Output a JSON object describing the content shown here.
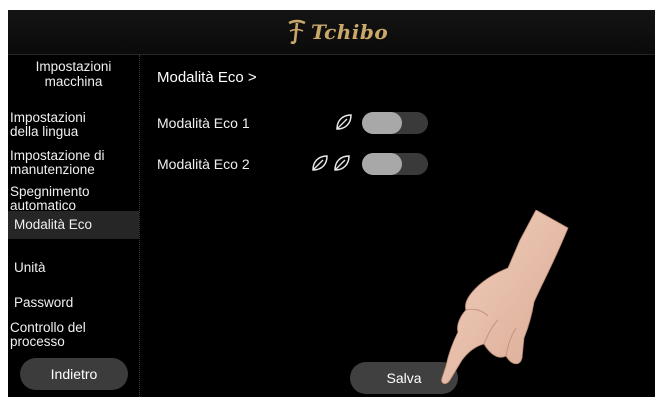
{
  "header": {
    "brand": "Tchibo",
    "logo_icon": "tchibo-cup-icon"
  },
  "sidebar": {
    "title_line1": "Impostazioni",
    "title_line2": "macchina",
    "items": [
      {
        "line1": "Impostazioni",
        "line2": "della lingua"
      },
      {
        "line1": "Impostazione di",
        "line2": "manutenzione"
      },
      {
        "line1": "Spegnimento",
        "line2": "automatico"
      },
      {
        "line1": "Modalità Eco",
        "line2": "",
        "active": true
      },
      {
        "line1": "Unità",
        "line2": ""
      },
      {
        "line1": "Password",
        "line2": ""
      },
      {
        "line1": "Controllo del",
        "line2": "processo"
      }
    ],
    "back_label": "Indietro"
  },
  "main": {
    "title": "Modalità Eco >",
    "options": [
      {
        "label": "Modalità Eco 1",
        "leaf_icons": 1,
        "enabled": false
      },
      {
        "label": "Modalità Eco 2",
        "leaf_icons": 2,
        "enabled": false
      }
    ],
    "save_label": "Salva"
  },
  "colors": {
    "background": "#000000",
    "brand_gold": "#c9a86a",
    "button": "#3c3c3c",
    "active_item": "#262626"
  }
}
